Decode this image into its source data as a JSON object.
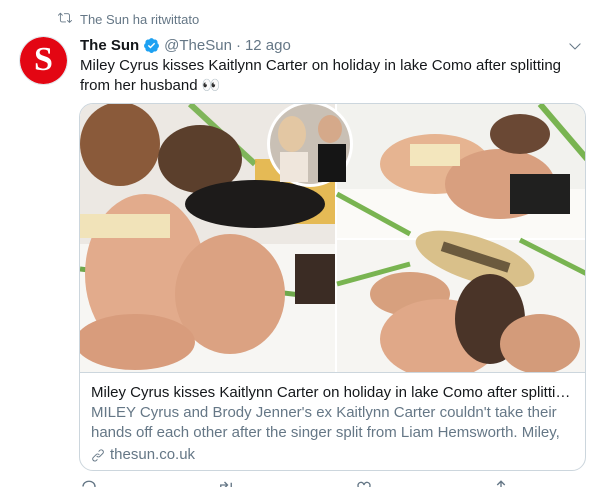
{
  "retweet_context": {
    "text": "The Sun ha ritwittato",
    "icon": "retweet-icon"
  },
  "author": {
    "name": "The Sun",
    "handle": "@TheSun",
    "time": "12 ago",
    "separator": "·",
    "verified": true,
    "avatar_letter": "S",
    "avatar_color": "#e30613"
  },
  "tweet": {
    "text": "Miley Cyrus kisses Kaitlynn Carter on holiday in lake Como after splitting from her husband",
    "emoji": "👀"
  },
  "card": {
    "title": "Miley Cyrus kisses Kaitlynn Carter on holiday in lake Como after splittin...",
    "description": "MILEY Cyrus and Brody Jenner's ex Kaitlynn Carter couldn't take their hands off each other after the singer split from Liam Hemsworth. Miley, ...",
    "domain": "thesun.co.uk"
  },
  "colors": {
    "text_primary": "#14171a",
    "text_secondary": "#657786",
    "verified_blue": "#1da1f2",
    "border": "#ccd6dd",
    "brand_red": "#e30613"
  }
}
